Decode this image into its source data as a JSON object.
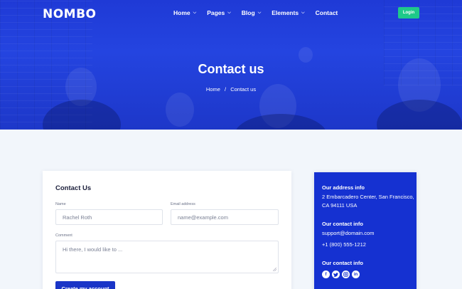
{
  "brand": {
    "logo_text": "NOMBO"
  },
  "nav": {
    "items": [
      {
        "label": "Home",
        "has_dropdown": true
      },
      {
        "label": "Pages",
        "has_dropdown": true
      },
      {
        "label": "Blog",
        "has_dropdown": true
      },
      {
        "label": "Elements",
        "has_dropdown": true
      },
      {
        "label": "Contact",
        "has_dropdown": false
      }
    ],
    "login_label": "Login"
  },
  "hero": {
    "title": "Contact us",
    "breadcrumb": {
      "home": "Home",
      "separator": "/",
      "current": "Contact us"
    }
  },
  "form": {
    "title": "Contact Us",
    "name_label": "Name",
    "name_value": "Rachel Roth",
    "email_label": "Email address",
    "email_placeholder": "name@example.com",
    "comment_label": "Comment",
    "comment_placeholder": "Hi there, I would like to ...",
    "submit_label": "Create my account"
  },
  "info": {
    "address_heading": "Our address info",
    "address_line1": "2 Embarcadero Center, San Francisco,",
    "address_line2": "CA 94111 USA",
    "contact_heading": "Our contact info",
    "email": "support@domain.com",
    "phone": "+1 (800) 555-1212",
    "social_heading": "Our contact info",
    "socials": [
      "facebook-icon",
      "twitter-icon",
      "instagram-icon",
      "linkedin-icon"
    ]
  },
  "colors": {
    "hero_blue": "#1f3ad6",
    "login_green": "#1ec98a",
    "submit_blue": "#1a35c7",
    "info_blue": "#1531d1",
    "page_bg": "#f2f6fb"
  }
}
